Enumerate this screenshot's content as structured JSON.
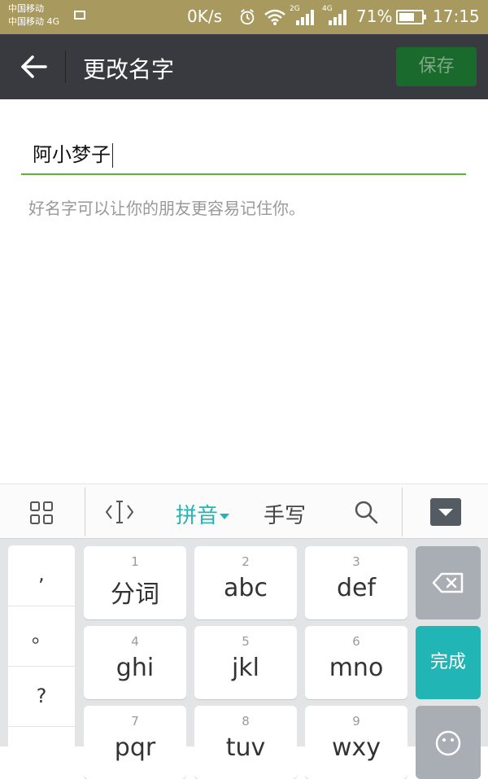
{
  "status_bar": {
    "carrier_line1": "中国移动",
    "carrier_line2": "中国移动 4G",
    "net_speed": "0K/s",
    "net_2g": "2G",
    "net_4g": "4G",
    "battery_percent": "71%",
    "battery_level": 0.71,
    "time": "17:15"
  },
  "header": {
    "title": "更改名字",
    "save_label": "保存",
    "accent_color": "#1b6a2d"
  },
  "form": {
    "name_value": "阿小梦子",
    "hint": "好名字可以让你的朋友更容易记住你。",
    "underline_color": "#59b43a"
  },
  "keyboard_toolbar": {
    "pinyin_label": "拼音",
    "handwrite_label": "手写",
    "pinyin_color": "#22b5b5",
    "icons": [
      "grid-icon",
      "cursor-icon",
      "search-icon",
      "hide-keyboard-icon"
    ]
  },
  "keyboard": {
    "punctuation": [
      ",",
      "。",
      "?"
    ],
    "keys": [
      {
        "num": "1",
        "label": "分词"
      },
      {
        "num": "2",
        "label": "abc"
      },
      {
        "num": "3",
        "label": "def"
      },
      {
        "num": "4",
        "label": "ghi"
      },
      {
        "num": "5",
        "label": "jkl"
      },
      {
        "num": "6",
        "label": "mno"
      },
      {
        "num": "7",
        "label": "pqr"
      },
      {
        "num": "8",
        "label": "tuv"
      },
      {
        "num": "9",
        "label": "wxy"
      }
    ],
    "done_label": "完成",
    "done_color": "#22b5b5"
  }
}
